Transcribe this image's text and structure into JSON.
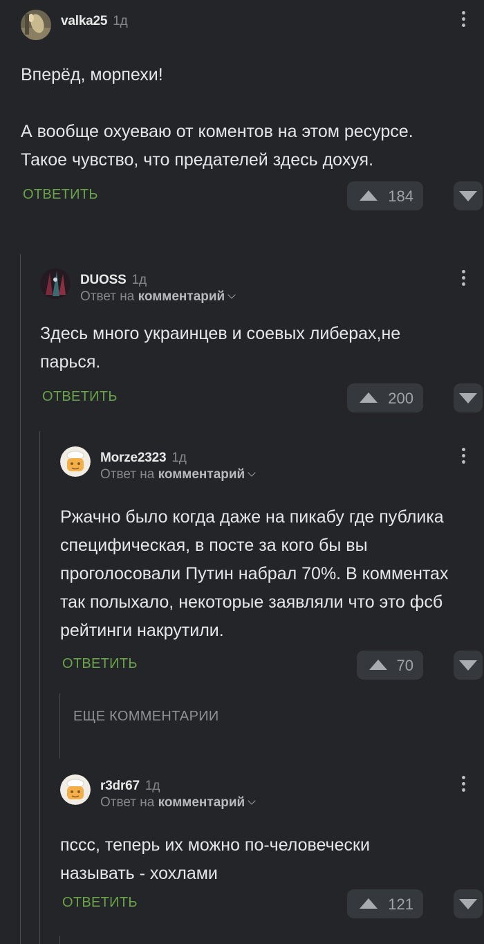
{
  "comments": [
    {
      "username": "valka25",
      "time": "1д",
      "reply_prefix": "",
      "reply_target": "",
      "text": "Вперёд, морпехи!\n\nА вообще охуеваю от коментов на этом ресурсе. Такое чувство, что предателей здесь дохуя.",
      "reply_label": "ОТВЕТИТЬ",
      "votes": "184"
    },
    {
      "username": "DUOSS",
      "time": "1д",
      "reply_prefix": "Ответ на",
      "reply_target": "комментарий",
      "text": "Здесь много украинцев и соевых либерах,не парься.",
      "reply_label": "ОТВЕТИТЬ",
      "votes": "200"
    },
    {
      "username": "Morze2323",
      "time": "1д",
      "reply_prefix": "Ответ на",
      "reply_target": "комментарий",
      "text": "Ржачно было когда даже на пикабу где публика специфическая, в посте за кого бы вы проголосовали Путин набрал 70%. В комментах так полыхало, некоторые заявляли что это фсб рейтинги накрутили.",
      "reply_label": "ОТВЕТИТЬ",
      "votes": "70"
    },
    {
      "username": "r3dr67",
      "time": "1д",
      "reply_prefix": "Ответ на",
      "reply_target": "комментарий",
      "text": "пссс, теперь их можно по-человечески называть - хохлами",
      "reply_label": "ОТВЕТИТЬ",
      "votes": "121"
    }
  ],
  "more_comments_label": "ЕЩЕ КОММЕНТАРИИ",
  "icons": {
    "vote_up": "triangle-up-icon",
    "vote_down": "triangle-down-icon",
    "menu": "kebab-menu-icon",
    "dropdown": "chevron-down-icon"
  },
  "colors": {
    "background": "#232528",
    "reply_action": "#69a548",
    "vote_button": "#35383c"
  }
}
